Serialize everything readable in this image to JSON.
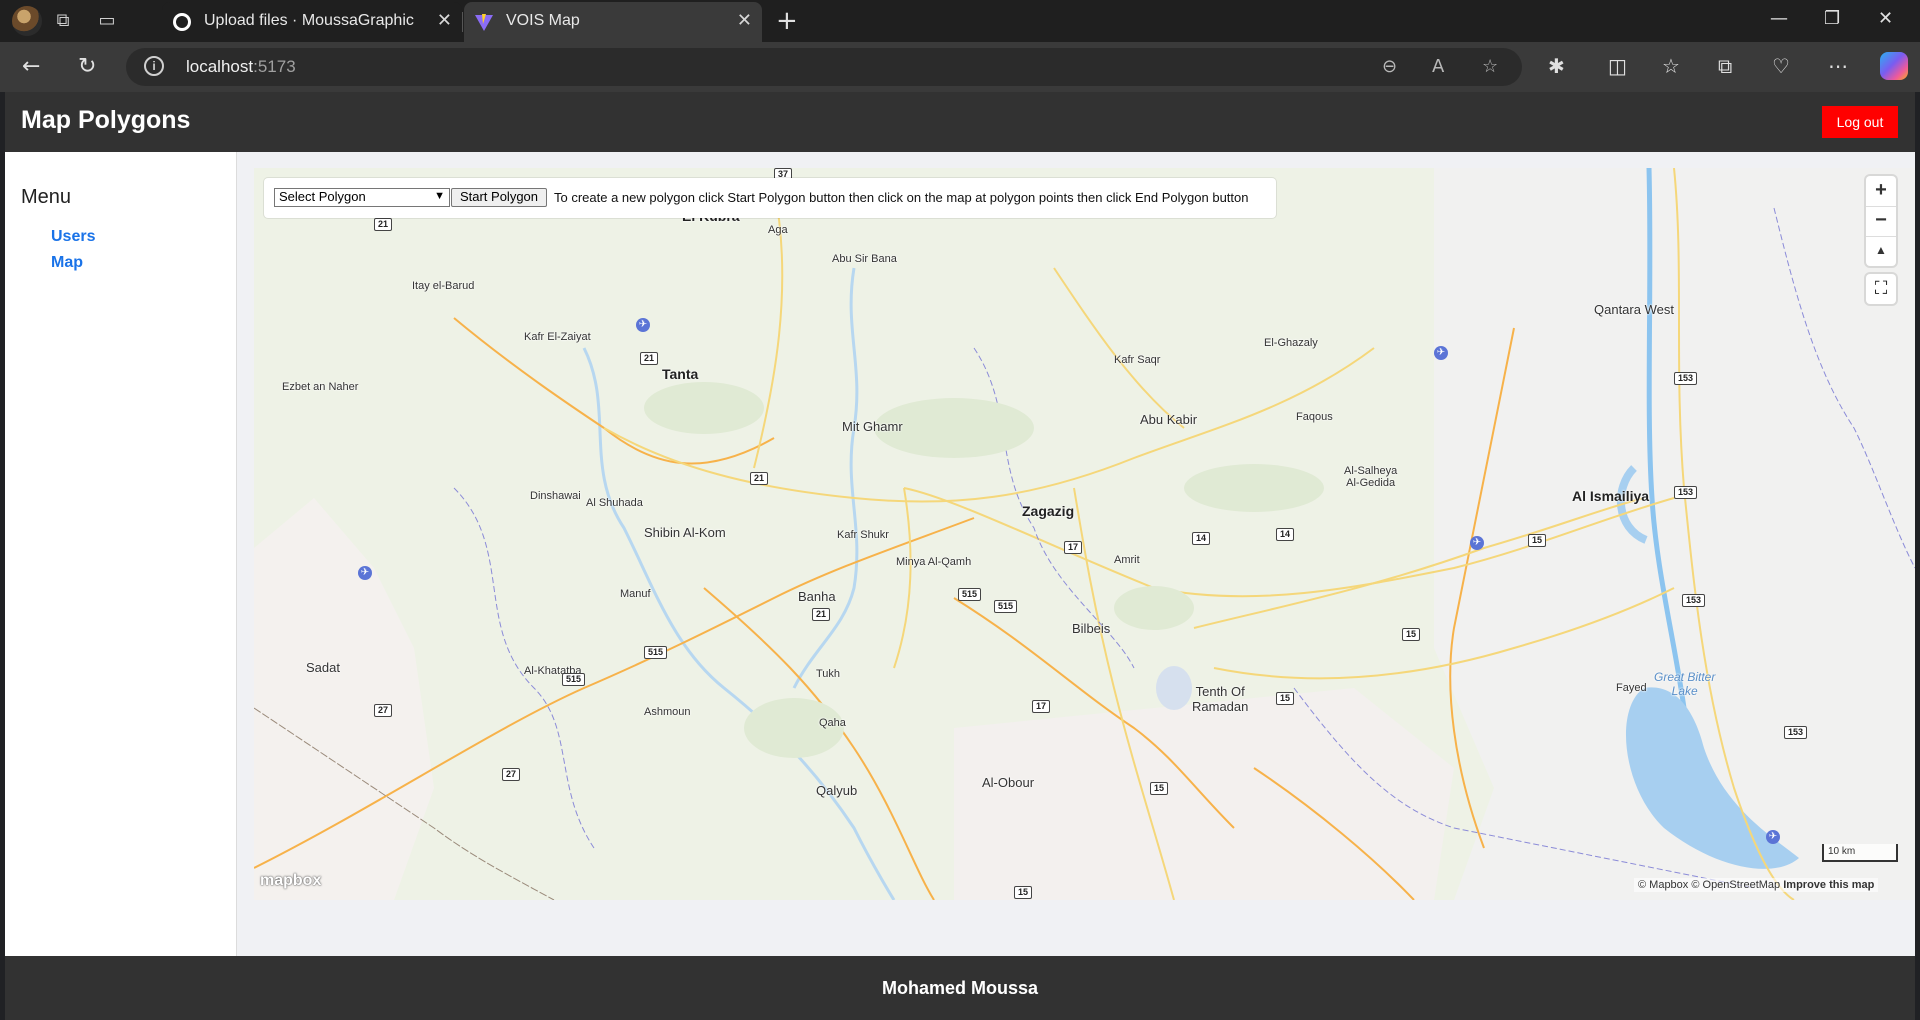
{
  "browser": {
    "tabs": [
      {
        "title": "Upload files · MoussaGraphicsPro",
        "close": "✕"
      },
      {
        "title": "VOIS Map",
        "close": "✕"
      }
    ],
    "new_tab": "+",
    "url_host": "localhost",
    "url_port": ":5173"
  },
  "header": {
    "title": "Map Polygons",
    "logout_label": "Log out"
  },
  "sidebar": {
    "title": "Menu",
    "items": [
      {
        "label": "Users"
      },
      {
        "label": "Map"
      }
    ]
  },
  "map_controls": {
    "select_value": "Select Polygon",
    "start_label": "Start Polygon",
    "hint": "To create a new polygon click Start Polygon button then click on the map at polygon points then click End Polygon button"
  },
  "map": {
    "zoom_in": "+",
    "zoom_out": "−",
    "compass": "▲",
    "logo": "mapbox",
    "scale": "10 km",
    "attribution": "© Mapbox © OpenStreetMap",
    "improve": "Improve this map",
    "labels": {
      "el_kubra": "El Kubra",
      "aga": "Aga",
      "abu_sir_bana": "Abu Sir Bana",
      "itay_el_barud": "Itay el-Barud",
      "kafr_el_zaiyat": "Kafr El-Zaiyat",
      "tanta": "Tanta",
      "ezbet_an_naher": "Ezbet an Naher",
      "mit_ghamr": "Mit Ghamr",
      "kafr_saqr": "Kafr Saqr",
      "el_ghazaly": "El-Ghazaly",
      "abu_kabir": "Abu Kabir",
      "faqous": "Faqous",
      "qantara_west": "Qantara West",
      "al_salheya": "Al-Salheya\nAl-Gedida",
      "al_ismailiya": "Al Ismailiya",
      "zagazig": "Zagazig",
      "dinshawai": "Dinshawai",
      "al_shuhada": "Al Shuhada",
      "shibin_al_kom": "Shibin Al-Kom",
      "kafr_shukr": "Kafr Shukr",
      "minya_al_qamh": "Minya Al-Qamh",
      "amrit": "Amrit",
      "manuf": "Manuf",
      "banha": "Banha",
      "bilbeis": "Bilbeis",
      "sadat": "Sadat",
      "al_khatatba": "Al-Khatatba",
      "tukh": "Tukh",
      "tenth_of_ramadan": "Tenth Of\nRamadan",
      "fayed": "Fayed",
      "great_bitter_lake": "Great Bitter\nLake",
      "ashmoun": "Ashmoun",
      "qaha": "Qaha",
      "al_obour": "Al-Obour",
      "qalyub": "Qalyub"
    },
    "shields": [
      "37",
      "21",
      "21",
      "21",
      "153",
      "153",
      "153",
      "153",
      "14",
      "14",
      "15",
      "17",
      "515",
      "515",
      "21",
      "515",
      "515",
      "15",
      "27",
      "17",
      "27",
      "15",
      "15",
      "15"
    ]
  },
  "footer": {
    "text": "Mohamed Moussa"
  },
  "colors": {
    "header_bg": "#323232",
    "logout_bg": "#ff0000",
    "link": "#1a73e8",
    "map_land": "#eef2e6",
    "water": "#a7cff0",
    "road_major": "#f7b24a",
    "road_minor": "#f5d77a"
  }
}
